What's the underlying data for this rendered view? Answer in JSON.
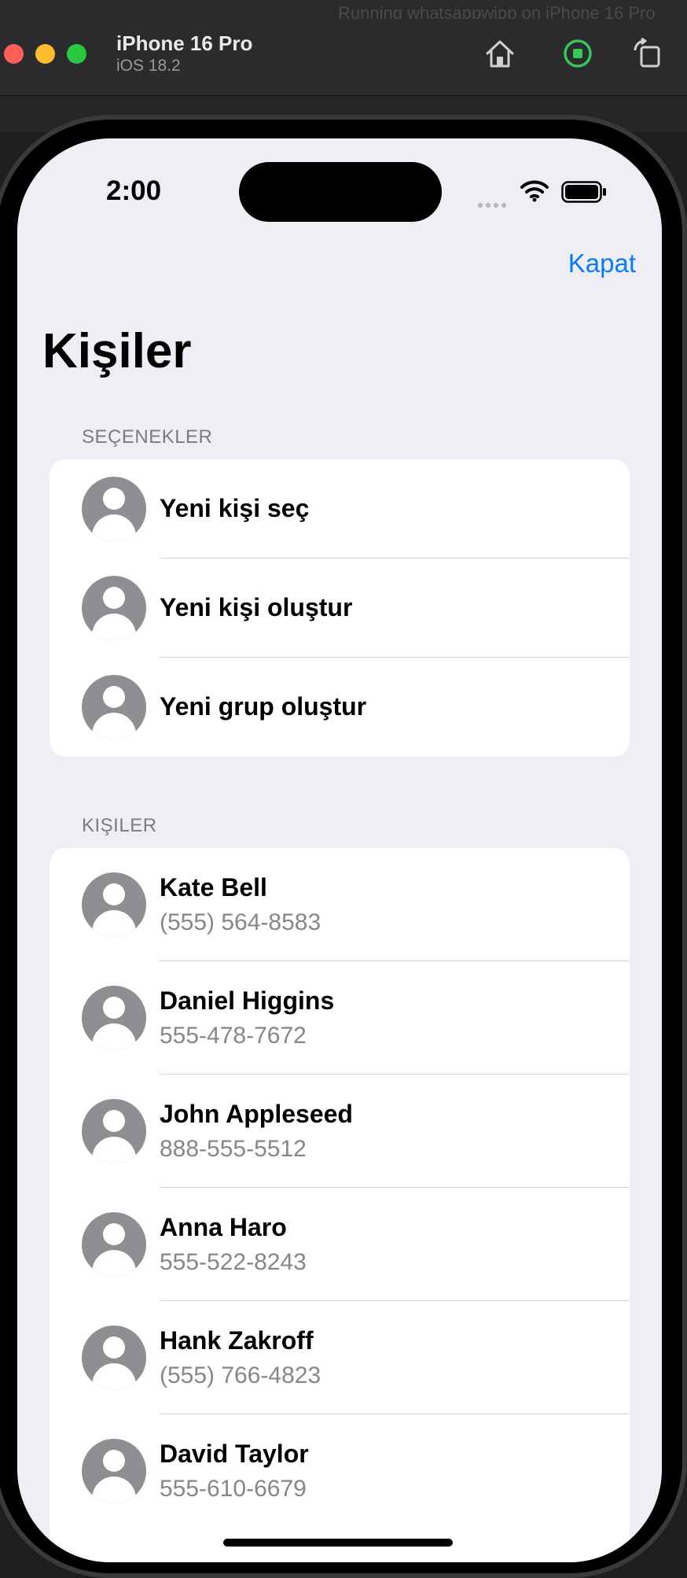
{
  "window": {
    "ghost_title": "Running whatsappwipp on iPhone 16 Pro",
    "device_name": "iPhone 16 Pro",
    "os_version": "iOS 18.2"
  },
  "status_bar": {
    "time": "2:00"
  },
  "nav": {
    "close_label": "Kapat",
    "title": "Kişiler"
  },
  "options": {
    "header": "SEÇENEKLER",
    "items": [
      {
        "label": "Yeni kişi seç"
      },
      {
        "label": "Yeni kişi oluştur"
      },
      {
        "label": "Yeni grup oluştur"
      }
    ]
  },
  "contacts": {
    "header": "KIŞILER",
    "items": [
      {
        "name": "Kate Bell",
        "phone": "(555) 564-8583"
      },
      {
        "name": "Daniel Higgins",
        "phone": "555-478-7672"
      },
      {
        "name": "John Appleseed",
        "phone": "888-555-5512"
      },
      {
        "name": "Anna Haro",
        "phone": "555-522-8243"
      },
      {
        "name": "Hank Zakroff",
        "phone": "(555) 766-4823"
      },
      {
        "name": "David Taylor",
        "phone": "555-610-6679"
      }
    ]
  },
  "colors": {
    "accent": "#0a7aff",
    "avatar": "#8e8e93",
    "background": "#efeef4"
  }
}
